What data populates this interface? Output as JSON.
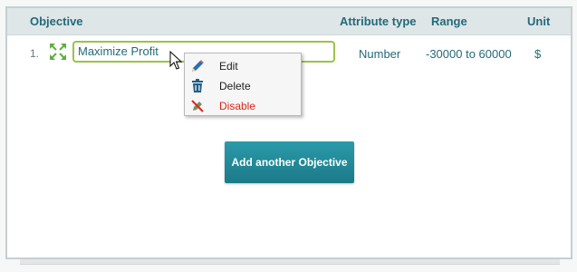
{
  "table": {
    "headers": {
      "objective": "Objective",
      "attribute_type": "Attribute type",
      "range": "Range",
      "unit": "Unit"
    },
    "rows": [
      {
        "number": "1.",
        "objective": "Maximize Profit",
        "attribute_type": "Number",
        "range": "-30000 to 60000",
        "unit": "$"
      }
    ]
  },
  "context_menu": {
    "items": [
      {
        "label": "Edit",
        "icon": "pencil-icon"
      },
      {
        "label": "Delete",
        "icon": "trash-icon"
      },
      {
        "label": "Disable",
        "icon": "disable-icon"
      }
    ]
  },
  "add_button_label": "Add another Objective",
  "colors": {
    "header_text": "#236a7a",
    "accent": "#1c7a88",
    "input_border": "#9bc348",
    "disable_text": "#e0261b"
  }
}
